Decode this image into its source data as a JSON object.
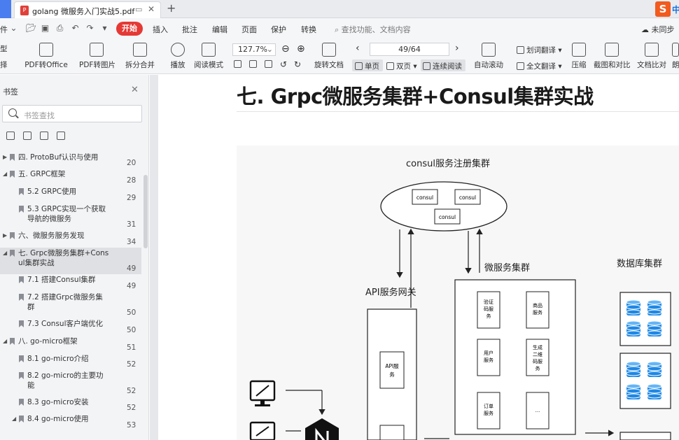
{
  "tab": {
    "title": "golang 微服务入门实战5.pdf",
    "pdf_badge": "P",
    "new_tab": "+",
    "logo": "S",
    "logo_text": "中"
  },
  "menu": {
    "left_cut": "件",
    "quick_chevron": "▾",
    "start": "开始",
    "items": [
      "插入",
      "批注",
      "编辑",
      "页面",
      "保护",
      "转换"
    ],
    "search": "查找功能、文档内容",
    "cloud": "未同步"
  },
  "toolbar": {
    "left_cut_top": "型",
    "left_cut_bottom": "择",
    "pdf_to_office": "PDF转Office",
    "pdf_to_image": "PDF转图片",
    "split_merge": "拆分合并",
    "play": "播放",
    "read_mode": "阅读模式",
    "zoom": "127.7%",
    "page": "49/64",
    "rotate": "旋转文档",
    "single": "单页",
    "double": "双页",
    "continuous": "连续阅读",
    "auto_scroll": "自动滚动",
    "word_translate": "划词翻译",
    "full_translate": "全文翻译",
    "compress": "压缩",
    "screenshot": "截图和对比",
    "compare": "文档比对",
    "cut_right": "朗"
  },
  "sidebar": {
    "title": "书签",
    "search_placeholder": "书签查找",
    "bookmarks": [
      {
        "label": "四. ProtoBuf认识与使用",
        "page": "20"
      },
      {
        "label": "五. GRPC框架",
        "page": "28"
      },
      {
        "label": "5.2 GRPC使用",
        "page": "29"
      },
      {
        "label": "5.3 GRPC实现一个获取",
        "label2": "导航的微服务",
        "page": "31"
      },
      {
        "label": "六、微服务服务发现",
        "page": "34"
      },
      {
        "label": "七. Grpc微服务集群+Cons",
        "label2": "ul集群实战",
        "page": "49"
      },
      {
        "label": "7.1 搭建Consul集群",
        "page": "49"
      },
      {
        "label": "7.2 搭建Grpc微服务集",
        "label2": "群",
        "page": "50"
      },
      {
        "label": "7.3 Consul客户端优化",
        "page": "50"
      },
      {
        "label": "八. go-micro框架",
        "page": "51"
      },
      {
        "label": "8.1 go-micro介绍",
        "page": "52"
      },
      {
        "label": "8.2 go-micro的主要功",
        "label2": "能",
        "page": "52"
      },
      {
        "label": "8.3 go-micro安装",
        "page": "52"
      },
      {
        "label": "8.4 go-micro使用",
        "page": "53"
      }
    ]
  },
  "document": {
    "heading": "七. Grpc微服务集群+Consul集群实战",
    "diagram": {
      "consul_cluster": "consul服务注册集群",
      "consul_node": "consul",
      "api_gateway": "API服务网关",
      "api_service_1": "API服",
      "api_service_2": "务",
      "micro_cluster": "微服务集群",
      "db_cluster": "数据库集群",
      "svc_verify": [
        "验证",
        "码服",
        "务"
      ],
      "svc_goods": [
        "商品",
        "服务"
      ],
      "svc_user": [
        "用户",
        "服务"
      ],
      "svc_qrcode": [
        "生成",
        "二维",
        "码服",
        "务"
      ],
      "svc_order": [
        "订单",
        "服务"
      ],
      "svc_more": "..."
    }
  }
}
